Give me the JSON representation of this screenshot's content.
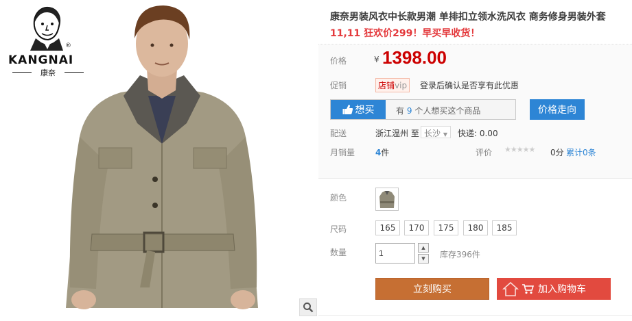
{
  "brand": {
    "name": "KANGNAI",
    "subtitle": "康奈",
    "registered": "®"
  },
  "product": {
    "title": "康奈男装风衣中长款男潮 单排扣立领水洗风衣 商务修身男装外套",
    "promo": "11,11 狂欢价299！早买早收货！"
  },
  "price": {
    "label": "价格",
    "currency": "¥",
    "value": "1398.00"
  },
  "promotion": {
    "label": "促销",
    "badge_main": "店铺",
    "badge_tag": "vip",
    "note": "登录后确认是否享有此优惠"
  },
  "want": {
    "button_label": "想买",
    "count_prefix": "有",
    "count": "9",
    "count_suffix": "个人想买这个商品"
  },
  "trend_button": "价格走向",
  "shipping": {
    "label": "配送",
    "from": "浙江温州",
    "to_word": "至",
    "destination": "长沙",
    "fee": "快递: 0.00"
  },
  "sales": {
    "label": "月销量",
    "count": "4",
    "unit": "件",
    "rating_label": "评价",
    "stars": "★★★★★",
    "score": "0分",
    "total_reviews": "累计0条"
  },
  "options": {
    "color_label": "颜色",
    "size_label": "尺码",
    "sizes": [
      "165",
      "170",
      "175",
      "180",
      "185"
    ],
    "quantity_label": "数量",
    "quantity_value": "1",
    "stock": "库存396件"
  },
  "actions": {
    "buy_now": "立刻购买",
    "add_to_cart": "加入购物车"
  },
  "colors": {
    "price_red": "#cc0000",
    "link_blue": "#2d85d5",
    "buy_orange": "#c66f33",
    "cart_red": "#e24a3f"
  },
  "icons": [
    "zoom-icon",
    "thumbs-up-icon",
    "cart-icon",
    "house-icon",
    "dropdown-arrow-icon"
  ]
}
